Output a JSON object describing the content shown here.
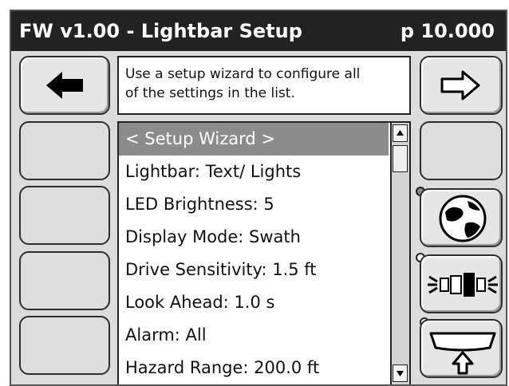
{
  "header": {
    "title": "FW v1.00 - Lightbar Setup",
    "page": "p 10.000"
  },
  "help_text": "Use a setup wizard to configure all\nof the settings in the list.",
  "list": {
    "items": [
      "< Setup Wizard >",
      "Lightbar: Text/ Lights",
      "LED Brightness: 5",
      "Display Mode: Swath",
      "Drive Sensitivity: 1.5 ft",
      "Look Ahead: 1.0 s",
      "Alarm: All",
      "Hazard Range: 200.0 ft"
    ],
    "selected_index": 0
  },
  "icons": {
    "back": "left-arrow-icon",
    "forward": "right-arrow-icon",
    "map": "globe-icon",
    "lightbar": "lightbar-icon",
    "upload": "screen-upload-icon"
  },
  "colors": {
    "titlebar": "#222222",
    "selection": "#8c8c8c",
    "panel": "#dcdcdc"
  }
}
